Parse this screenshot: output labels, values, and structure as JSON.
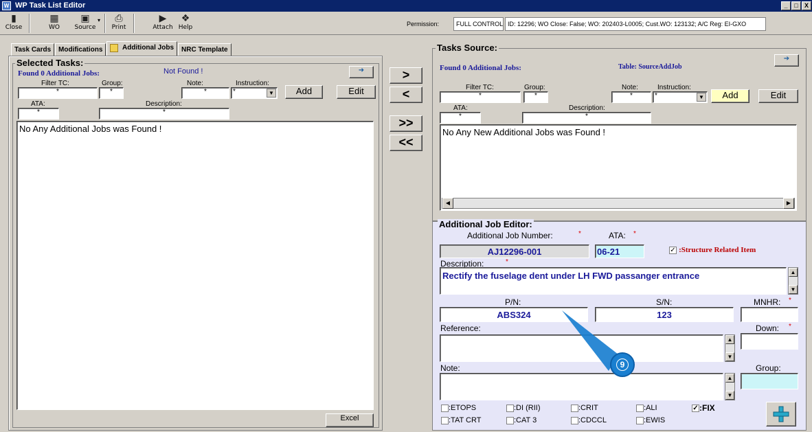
{
  "window": {
    "title": "WP Task List Editor",
    "controls": [
      "_",
      "□",
      "X"
    ]
  },
  "toolbar": {
    "buttons": [
      {
        "label": "Close",
        "icon": "close-door-icon"
      },
      {
        "label": "WO",
        "icon": "wo-icon"
      },
      {
        "label": "Source",
        "icon": "source-icon"
      },
      {
        "label": "Print",
        "icon": "print-icon"
      },
      {
        "label": "Attach",
        "icon": "attach-icon"
      },
      {
        "label": "Help",
        "icon": "help-icon"
      }
    ],
    "permission_label": "Permission:",
    "permission_value": "FULL CONTROL",
    "info": "ID: 12296; WO Close: False; WO: 202403-L0005; Cust.WO: 123132; A/C Reg: EI-GXO"
  },
  "tabs": [
    "Task Cards",
    "Modifications",
    "Additional Jobs",
    "NRC Template"
  ],
  "selected": {
    "title": "Selected Tasks:",
    "found": "Found 0 Additional Jobs:",
    "status": "Not Found !",
    "filter_tc_label": "Filter TC:",
    "group_label": "Group:",
    "note_label": "Note:",
    "instruction_label": "Instruction:",
    "ata_label": "ATA:",
    "description_label": "Description:",
    "wildcard": "*",
    "add": "Add",
    "edit": "Edit",
    "list_message": "No Any Additional Jobs was Found !",
    "excel": "Excel"
  },
  "transfer": {
    "move_right": ">",
    "move_left": "<",
    "move_all_right": ">>",
    "move_all_left": "<<"
  },
  "source": {
    "title": "Tasks Source:",
    "found": "Found 0 Additional Jobs:",
    "table": "Table: SourceAddJob",
    "filter_tc_label": "Filter TC:",
    "group_label": "Group:",
    "note_label": "Note:",
    "instruction_label": "Instruction:",
    "ata_label": "ATA:",
    "description_label": "Description:",
    "wildcard": "*",
    "add": "Add",
    "edit": "Edit",
    "list_message": "No Any New Additional Jobs was Found !"
  },
  "editor": {
    "title": "Additional Job Editor:",
    "job_number_label": "Additional Job Number:",
    "job_number": "AJ12296-001",
    "ata_label": "ATA:",
    "ata": "06-21",
    "structure_label": ":Structure Related Item",
    "structure_checked": true,
    "description_label": "Description:",
    "description": "Rectify the fuselage dent under LH FWD passanger entrance",
    "pn_label": "P/N:",
    "pn": "ABS324",
    "sn_label": "S/N:",
    "sn": "123",
    "mnhr_label": "MNHR:",
    "reference_label": "Reference:",
    "down_label": "Down:",
    "note_label": "Note:",
    "group_label": "Group:",
    "req": "*",
    "flags": [
      {
        "label": ":ETOPS",
        "checked": false
      },
      {
        "label": ":DI (RII)",
        "checked": false
      },
      {
        "label": ":CRIT",
        "checked": false
      },
      {
        "label": ":ALI",
        "checked": false
      },
      {
        "label": ":FIX",
        "checked": true
      },
      {
        "label": ":TAT CRT",
        "checked": false
      },
      {
        "label": ":CAT 3",
        "checked": false
      },
      {
        "label": ":CDCCL",
        "checked": false
      },
      {
        "label": ":EWIS",
        "checked": false
      }
    ],
    "add_icon": "plus-icon"
  },
  "callout": {
    "number": "9"
  },
  "colors": {
    "title_bar": "#0a246a",
    "callout": "#1a7fd0",
    "accent_blue": "#1a1a9a",
    "editor_bg": "#e6e6f8",
    "yellow_btn": "#ffffc0",
    "cyan_field": "#ccf5f8"
  }
}
